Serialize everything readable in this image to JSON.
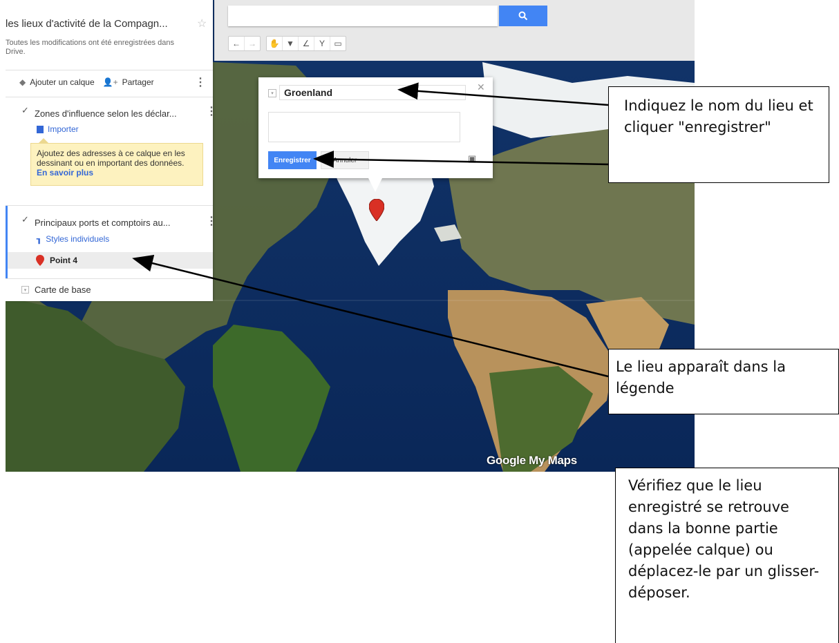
{
  "panel": {
    "map_title": "les lieux d'activité de la Compagn...",
    "save_status": "Toutes les modifications ont été enregistrées dans Drive.",
    "add_layer_label": "Ajouter un calque",
    "share_label": "Partager",
    "layers": [
      {
        "name": "Zones d'influence selon les déclar...",
        "action_label": "Importer",
        "tip_text": "Ajoutez des adresses à ce calque en les dessinant ou en important des données.",
        "tip_link": "En savoir plus"
      },
      {
        "name": "Principaux ports et comptoirs au...",
        "action_label": "Styles individuels",
        "items": [
          {
            "label": "Point 4"
          }
        ]
      }
    ],
    "basemap_label": "Carte de base"
  },
  "popup": {
    "name_value": "Groenland",
    "description_value": "",
    "save_label": "Enregistrer",
    "cancel_label": "Annuler"
  },
  "logo": "Google My Maps",
  "callouts": {
    "name_hint": "Indiquez le nom du lieu et cliquer \"enregistrer\"",
    "legend_hint": "Le lieu apparaît dans la légende",
    "verify_hint": "Vérifiez que le lieu enregistré se retrouve dans la bonne partie (appelée calque) ou déplacez-le par un glisser-déposer."
  },
  "colors": {
    "accent": "#4285f4",
    "marker": "#d93025",
    "link": "#3367d6"
  }
}
